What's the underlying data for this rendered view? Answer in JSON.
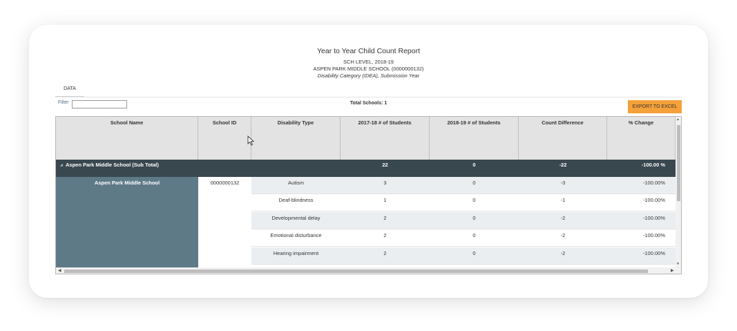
{
  "report": {
    "title": "Year to Year Child Count Report",
    "level": "SCH LEVEL, 2018-19",
    "school": "ASPEN PARK MIDDLE SCHOOL (0000000132)",
    "grouping": "Disability Category (IDEA), Submission Year"
  },
  "tabs": [
    {
      "label": "DATA",
      "active": true
    }
  ],
  "filter": {
    "label": "Filter",
    "value": ""
  },
  "total_schools": "Total Schools: 1",
  "export_label": "EXPORT TO EXCEL",
  "columns": [
    "School Name",
    "School ID",
    "Disability Type",
    "2017-18 # of Students",
    "2018-19 # of Students",
    "Count Difference",
    "% Change"
  ],
  "subtotal": {
    "label": "Aspen Park Middle School (Sub Total)",
    "y2017": "22",
    "y2018": "0",
    "diff": "-22",
    "pct": "-100.00 %"
  },
  "school_row": {
    "name": "Aspen Park Middle School",
    "id": "0000000132"
  },
  "rows": [
    {
      "type": "Autism",
      "y2017": "3",
      "y2018": "0",
      "diff": "-3",
      "pct": "-100.00%"
    },
    {
      "type": "Deaf-blindness",
      "y2017": "1",
      "y2018": "0",
      "diff": "-1",
      "pct": "-100.00%"
    },
    {
      "type": "Developmental delay",
      "y2017": "2",
      "y2018": "0",
      "diff": "-2",
      "pct": "-100.00%"
    },
    {
      "type": "Emotional disturbance",
      "y2017": "2",
      "y2018": "0",
      "diff": "-2",
      "pct": "-100.00%"
    },
    {
      "type": "Hearing impairment",
      "y2017": "2",
      "y2018": "0",
      "diff": "-2",
      "pct": "-100.00%"
    }
  ],
  "colors": {
    "accent": "#f5a13a",
    "subtotal_bg": "#39474f",
    "school_block": "#5f7a87",
    "header_bg": "#e3e3e3"
  }
}
